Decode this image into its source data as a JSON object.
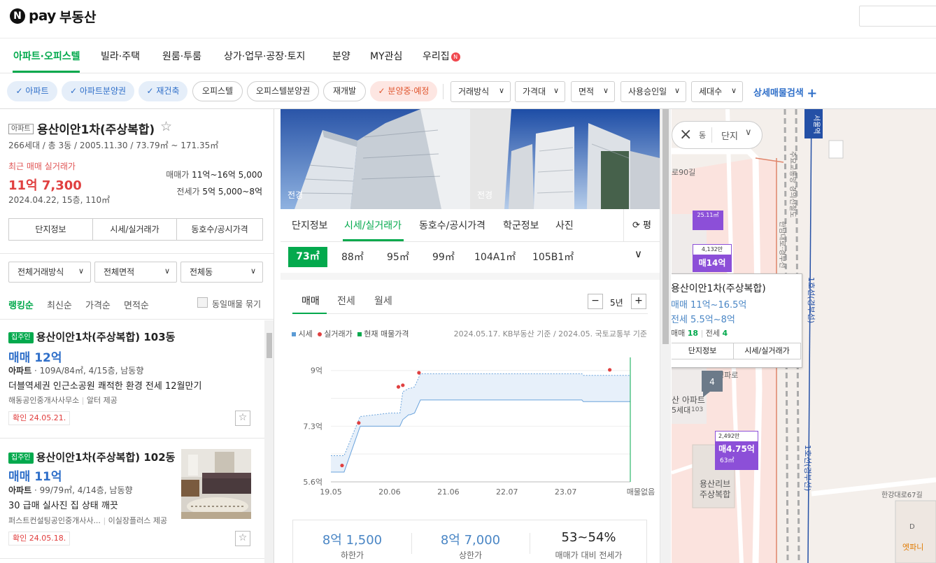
{
  "header": {
    "logo_n": "N",
    "logo_pay": "pay",
    "logo_text": "부동산"
  },
  "nav": [
    {
      "label": "아파트·오피스텔",
      "active": true
    },
    {
      "label": "빌라·주택"
    },
    {
      "label": "원룸·투룸"
    },
    {
      "label": "상가·업무·공장·토지"
    },
    {
      "label": "분양"
    },
    {
      "label": "MY관심"
    },
    {
      "label": "우리집",
      "new_badge": "N"
    }
  ],
  "filters": {
    "chips": [
      "아파트",
      "아파트분양권",
      "재건축",
      "오피스텔",
      "오피스텔분양권",
      "재개발",
      "분양중·예정"
    ],
    "dropdowns": [
      "거래방식",
      "가격대",
      "면적",
      "사용승인일",
      "세대수"
    ],
    "advanced": "상세매물검색",
    "plus": "+"
  },
  "complex": {
    "type_tag": "아파트",
    "name": "용산이안1차(주상복합)",
    "star": "☆",
    "summary": "266세대 / 총 3동 / 2005.11.30 / 73.79㎡ ~ 171.35㎡",
    "recent_label": "최근 매매 실거래가",
    "recent_price": "11억 7,300",
    "recent_detail": "2024.04.22, 15층, 110㎡",
    "sale_label": "매매가",
    "sale_range": "11억~16억 5,000",
    "jeonse_label": "전세가",
    "jeonse_range": "5억 5,000~8억",
    "buttons": [
      "단지정보",
      "시세/실거래가",
      "동호수/공시가격"
    ]
  },
  "list_filters": [
    "전체거래방식",
    "전체면적",
    "전체동"
  ],
  "sort": {
    "options": [
      "랭킹순",
      "최신순",
      "가격순",
      "면적순"
    ],
    "same_listing": "동일매물 묶기"
  },
  "listings": [
    {
      "badge": "집주인",
      "title": "용산이안1차(주상복합) 103동",
      "price": "매매 12억",
      "type": "아파트",
      "spec": "109A/84㎡, 4/15층, 남동향",
      "desc": "더블역세권 인근소공원 쾌적한 환경 전세 12월만기",
      "agency": "해동공인중개사사무소",
      "provider": "알터 제공",
      "confirmed": "확인 24.05.21."
    },
    {
      "badge": "집주인",
      "title": "용산이안1차(주상복합) 102동",
      "price": "매매 11억",
      "type": "아파트",
      "spec": "99/79㎡, 4/14층, 남동향",
      "desc": "30 급매 실사진 집 상태 깨끗",
      "agency": "퍼스트컨설팅공인중개사사...",
      "provider": "이실장플러스 제공",
      "confirmed": "확인 24.05.18."
    }
  ],
  "photos": [
    {
      "caption": "전경"
    },
    {
      "caption": "전경"
    }
  ],
  "mid_tabs": [
    "단지정보",
    "시세/실거래가",
    "동호수/공시가격",
    "학군정보",
    "사진"
  ],
  "unit_toggle": "평",
  "area_tabs": [
    "73㎡",
    "88㎡",
    "95㎡",
    "99㎡",
    "104A1㎡",
    "105B1㎡"
  ],
  "deal_tabs": [
    "매매",
    "전세",
    "월세"
  ],
  "period": {
    "minus": "−",
    "value": "5년",
    "plus": "+"
  },
  "chart_data": {
    "type": "line",
    "legend": [
      "시세",
      "실거래가",
      "현재 매물가격"
    ],
    "source": "2024.05.17. KB부동산 기준 / 2024.05. 국토교통부 기준",
    "x_ticks": [
      "19.05",
      "20.06",
      "21.06",
      "22.07",
      "23.07"
    ],
    "x_end_label": "매물없음",
    "y_ticks": [
      "9억",
      "7.3억",
      "5.6억"
    ],
    "ylim": [
      5.6,
      9.4
    ],
    "series": [
      {
        "name": "시세",
        "x": [
          0,
          0.45,
          1.0,
          1.05,
          2.0,
          2.05,
          2.35,
          2.45,
          2.65,
          2.7,
          2.85,
          3.05,
          4.0,
          6.0,
          6.05,
          8.55,
          8.6,
          10.2,
          10.2
        ],
        "upper": [
          6.4,
          6.4,
          7.6,
          7.6,
          7.7,
          7.7,
          7.7,
          8.35,
          8.45,
          8.45,
          8.5,
          8.9,
          8.9,
          8.9,
          8.9,
          8.9,
          8.85,
          8.85,
          8.85
        ],
        "lower": [
          5.9,
          5.9,
          7.3,
          7.3,
          7.3,
          7.3,
          7.3,
          7.5,
          7.65,
          7.65,
          7.7,
          8.1,
          8.1,
          8.1,
          8.1,
          8.1,
          8.05,
          8.05,
          8.05
        ]
      },
      {
        "name": "실거래가",
        "points": [
          [
            0.38,
            6.1
          ],
          [
            0.95,
            7.4
          ],
          [
            2.3,
            8.5
          ],
          [
            2.45,
            8.55
          ],
          [
            3.0,
            8.93
          ],
          [
            9.5,
            9.02
          ]
        ]
      }
    ],
    "current_listing_x": 10.2
  },
  "summary": [
    {
      "value": "8억 1,500",
      "label": "하한가"
    },
    {
      "value": "8억 7,000",
      "label": "상한가"
    },
    {
      "value": "53~54%",
      "label": "매매가 대비 전세가"
    }
  ],
  "map": {
    "top_chip": "단지",
    "close": "×",
    "dong_label": "동",
    "popup": {
      "title": "용산이안1차(주상복합)",
      "sale": "매매 11억~16.5억",
      "jeonse": "전세 5.5억~8억",
      "sale_count_label": "매매",
      "sale_count": "18",
      "jeonse_count_label": "전세",
      "jeonse_count": "4",
      "buttons": [
        "단지정보",
        "시세/실거래가"
      ]
    },
    "markers": [
      {
        "area": "25.11㎡"
      },
      {
        "top": "4,132만",
        "price": "매14억"
      },
      {
        "top": "2,492만",
        "price": "매4.75억",
        "area": "63㎡"
      }
    ],
    "cluster": "4",
    "labels": {
      "road90": "로90길",
      "line1_a": "1호선(경부선)",
      "line1_b": "1호선(경부선)",
      "cheongpa": "청파로",
      "apt": "산 아파트",
      "apt2": "5세대",
      "apt3": "103",
      "liv1": "용산리브",
      "liv2": "주상복합",
      "hangang": "한강대로67길",
      "highway": "주요교통망 경의선철도",
      "side": "한남대로·경부선",
      "station": "서울역",
      "d": "D",
      "etpani": "엣파니"
    }
  }
}
